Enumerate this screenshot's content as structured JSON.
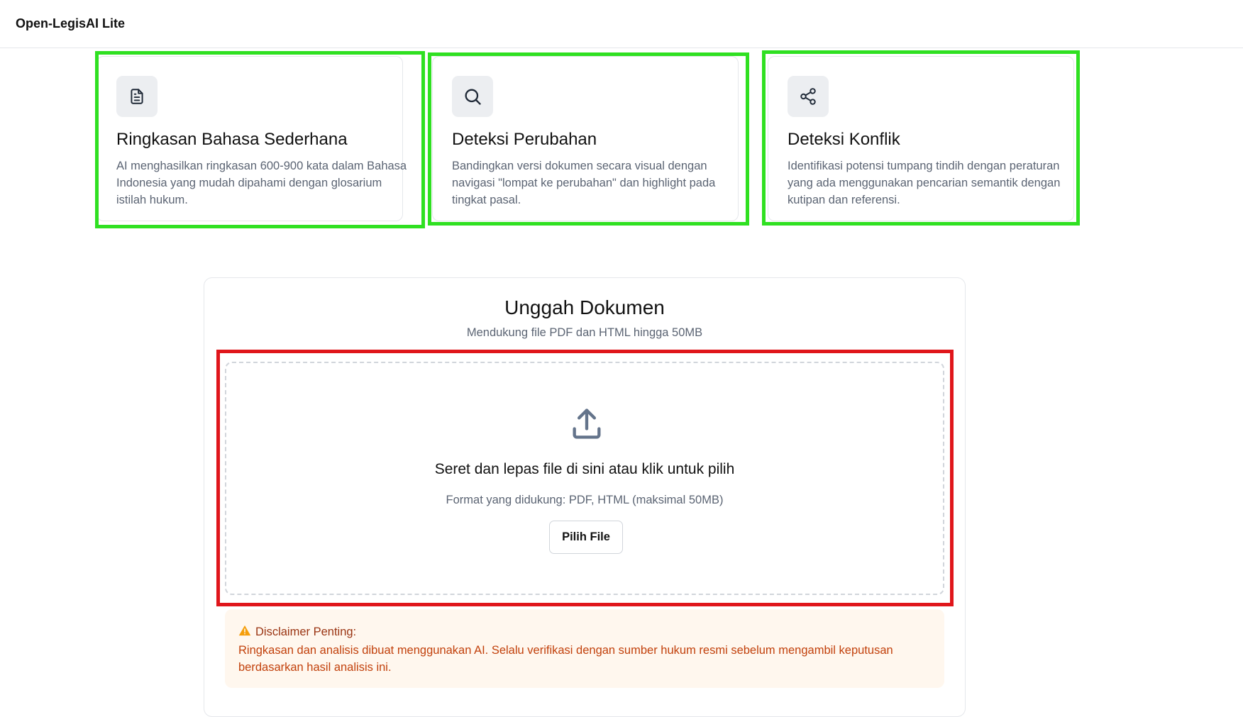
{
  "app": {
    "title": "Open-LegisAI Lite"
  },
  "features": [
    {
      "icon": "document-icon",
      "title": "Ringkasan Bahasa Sederhana",
      "description": "AI menghasilkan ringkasan 600-900 kata dalam Bahasa Indonesia yang mudah dipahami dengan glosarium istilah hukum."
    },
    {
      "icon": "search-icon",
      "title": "Deteksi Perubahan",
      "description": "Bandingkan versi dokumen secara visual dengan navigasi \"lompat ke perubahan\" dan highlight pada tingkat pasal."
    },
    {
      "icon": "share-icon",
      "title": "Deteksi Konflik",
      "description": "Identifikasi potensi tumpang tindih dengan peraturan yang ada menggunakan pencarian semantik dengan kutipan dan referensi."
    }
  ],
  "upload": {
    "title": "Unggah Dokumen",
    "subtitle": "Mendukung file PDF dan HTML hingga 50MB",
    "dropzone_title": "Seret dan lepas file di sini atau klik untuk pilih",
    "formats": "Format yang didukung: PDF, HTML (maksimal 50MB)",
    "button_label": "Pilih File",
    "icon": "upload-icon"
  },
  "disclaimer": {
    "icon": "warning-icon",
    "title": "Disclaimer Penting:",
    "text": "Ringkasan dan analisis dibuat menggunakan AI. Selalu verifikasi dengan sumber hukum resmi sebelum mengambil keputusan berdasarkan hasil analisis ini."
  },
  "colors": {
    "highlight_green": "#2fe021",
    "highlight_red": "#e0161b",
    "muted_text": "#5b6473",
    "warning_bg": "#fff7ee",
    "warning_text": "#c2410c"
  }
}
